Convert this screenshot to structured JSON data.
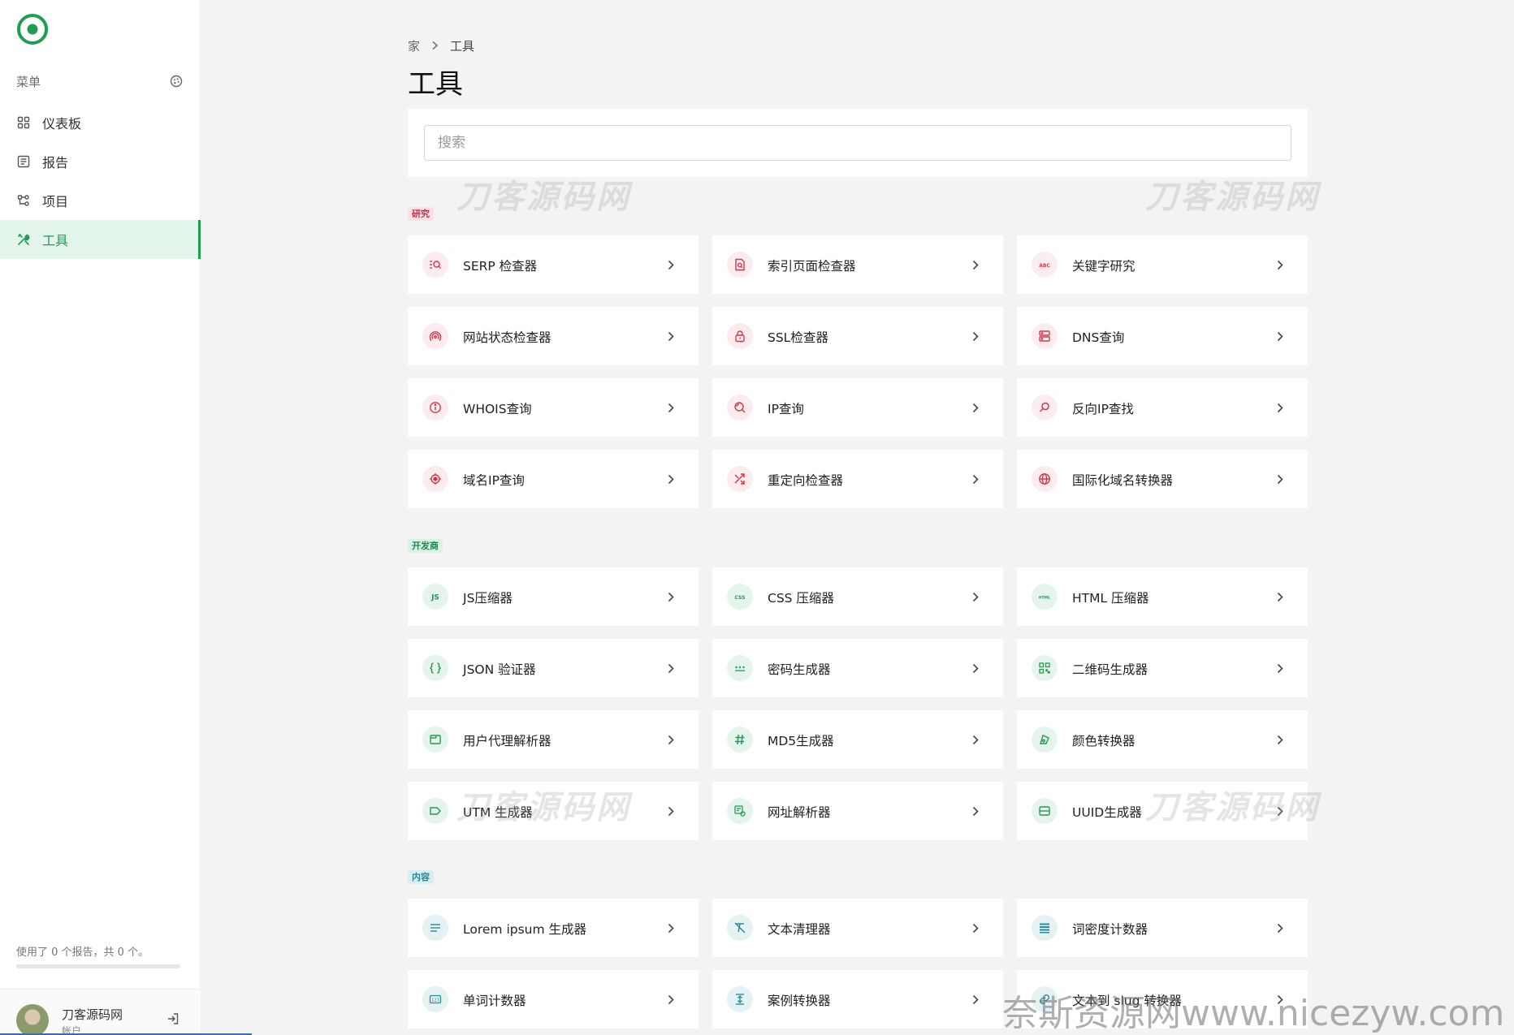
{
  "sidebar": {
    "menu_title": "菜单",
    "items": [
      {
        "label": "仪表板",
        "icon": "grid-icon",
        "active": false
      },
      {
        "label": "报告",
        "icon": "report-icon",
        "active": false
      },
      {
        "label": "项目",
        "icon": "project-icon",
        "active": false
      },
      {
        "label": "工具",
        "icon": "tools-icon",
        "active": true
      }
    ],
    "usage_text": "使用了 0 个报告，共 0 个。",
    "usage_fraction": 0,
    "user_name": "刀客源码网",
    "user_sub": "帐户"
  },
  "breadcrumb": {
    "home": "家",
    "current": "工具"
  },
  "page_title": "工具",
  "search": {
    "placeholder": "搜索",
    "value": ""
  },
  "sections": {
    "research": {
      "badge": "研究",
      "tools": [
        "SERP 检查器",
        "索引页面检查器",
        "关键字研究",
        "网站状态检查器",
        "SSL检查器",
        "DNS查询",
        "WHOIS查询",
        "IP查询",
        "反向IP查找",
        "域名IP查询",
        "重定向检查器",
        "国际化域名转换器"
      ]
    },
    "developer": {
      "badge": "开发商",
      "tools": [
        "JS压缩器",
        "CSS 压缩器",
        "HTML 压缩器",
        "JSON 验证器",
        "密码生成器",
        "二维码生成器",
        "用户代理解析器",
        "MD5生成器",
        "颜色转换器",
        "UTM 生成器",
        "网址解析器",
        "UUID生成器"
      ]
    },
    "content": {
      "badge": "内容",
      "tools": [
        "Lorem ipsum 生成器",
        "文本清理器",
        "词密度计数器",
        "单词计数器",
        "案例转换器",
        "文本到 slug 转换器"
      ]
    }
  },
  "watermark": {
    "text": "刀客源码网",
    "footer": "奈斯资源网www.nicezyw.com"
  },
  "colors": {
    "accent": "#1f9d55",
    "research": "#d2394e",
    "developer": "#249a52",
    "content": "#2b8c9c"
  }
}
